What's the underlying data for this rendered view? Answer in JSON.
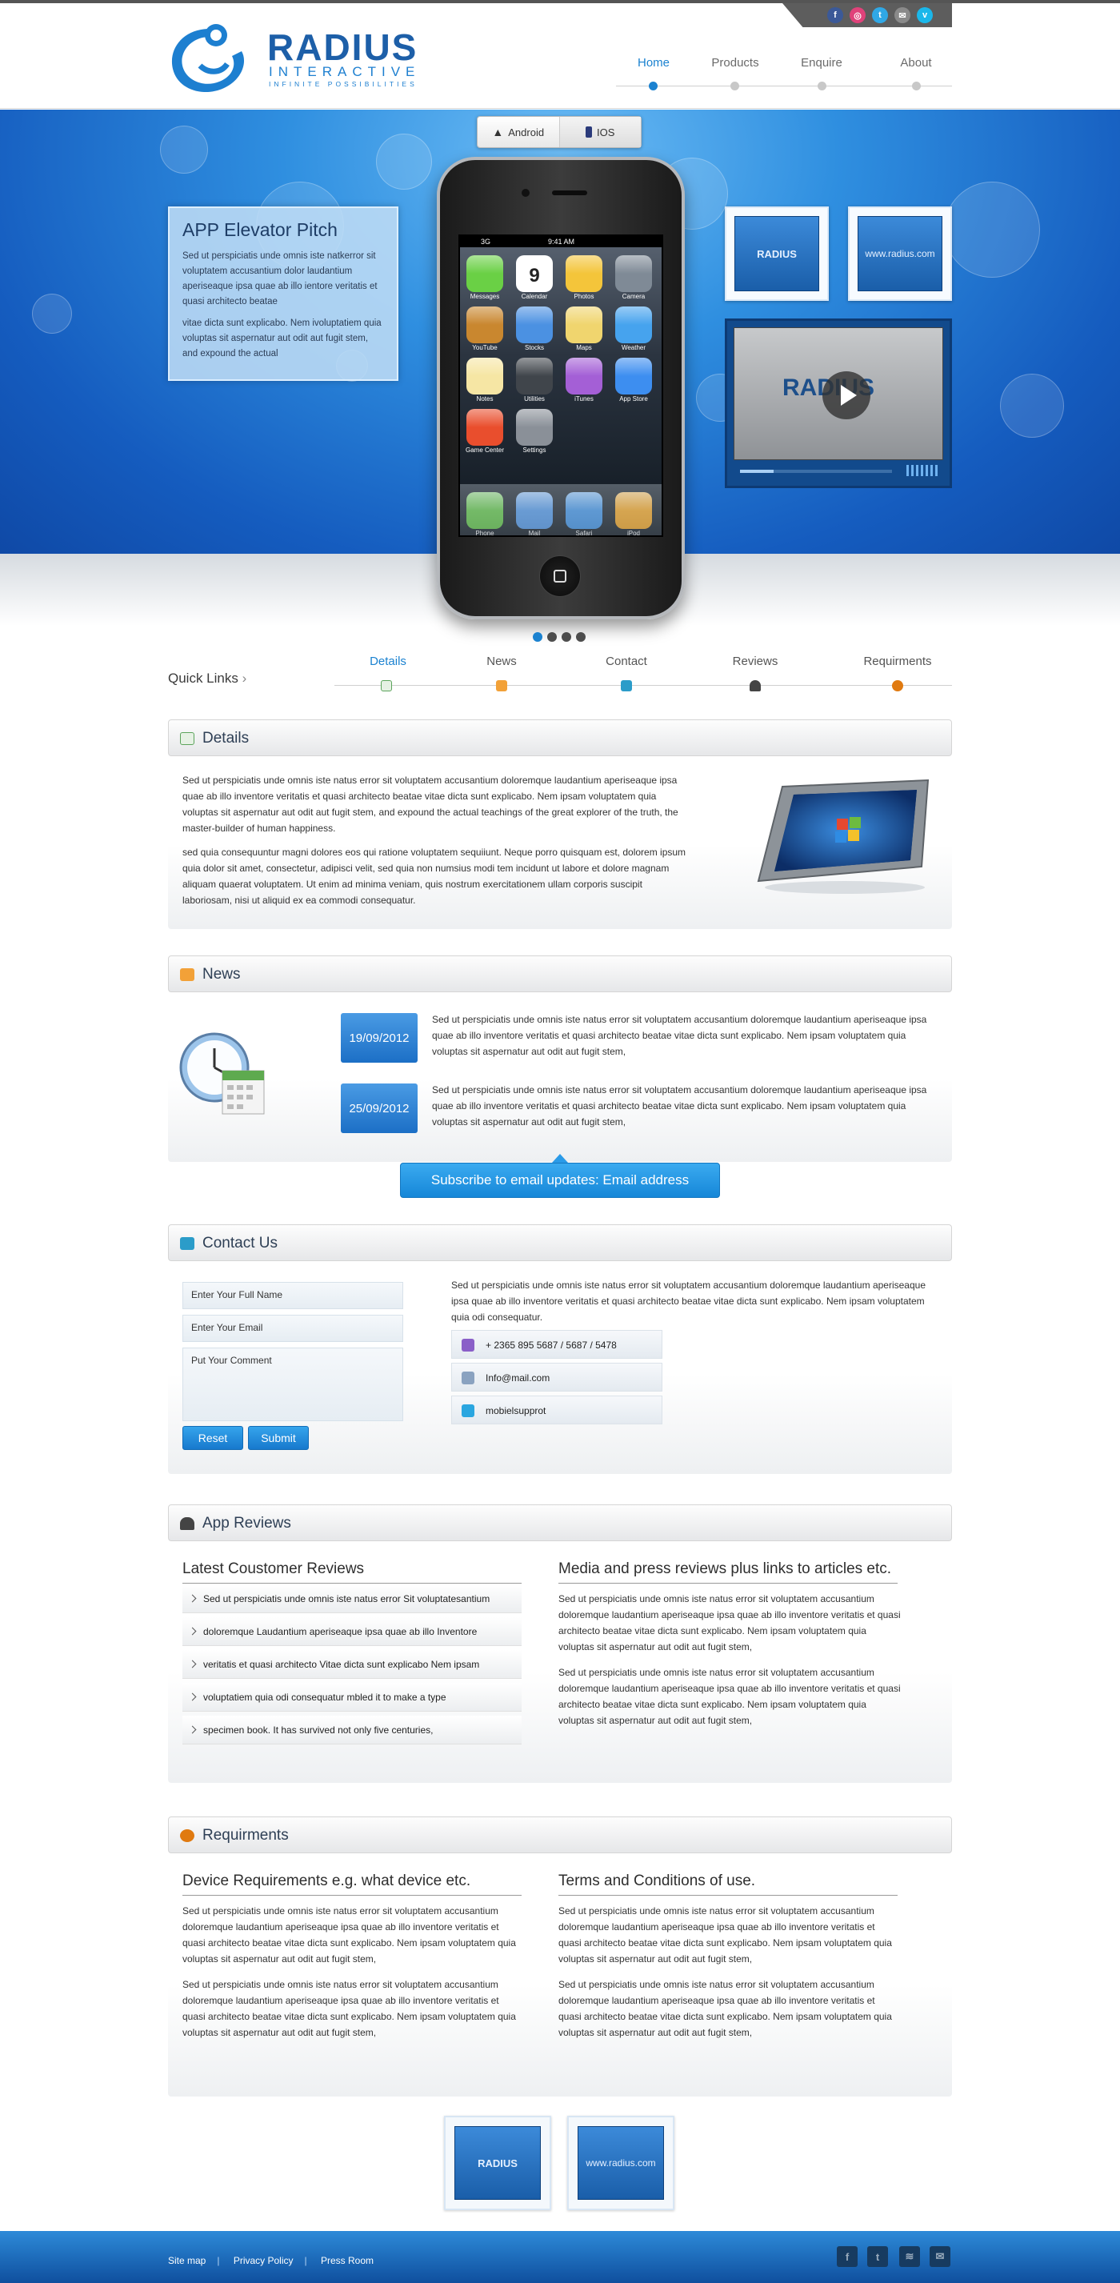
{
  "brand": {
    "name": "RADIUS",
    "sub": "INTERACTIVE",
    "tagline": "INFINITE POSSIBILITIES"
  },
  "social": [
    "f",
    "◎",
    "t",
    "✉",
    "v"
  ],
  "nav": [
    {
      "label": "Home"
    },
    {
      "label": "Products"
    },
    {
      "label": "Enquire"
    },
    {
      "label": "About"
    }
  ],
  "hero": {
    "pitch_title": "APP Elevator Pitch",
    "pitch_p1": "Sed ut perspiciatis unde omnis iste natkerror sit voluptatem accusantium dolor laudantium aperiseaque ipsa quae ab illo ientore veritatis et quasi architecto beatae",
    "pitch_p2": "vitae dicta sunt explicabo. Nem ivoluptatiem quia voluptas sit aspernatur aut odit aut fugit stem, and expound the actual",
    "platform_android": "Android",
    "platform_ios": "IOS",
    "status_carrier": "3G",
    "status_time": "9:41 AM",
    "thumb1": "RADIUS",
    "thumb2": "www.radius.com",
    "video_logo": "RADIUS"
  },
  "apps": [
    {
      "label": "Messages",
      "color": "#6ad045"
    },
    {
      "label": "Calendar",
      "color": "#ffffff"
    },
    {
      "label": "Photos",
      "color": "#f4c53a"
    },
    {
      "label": "Camera",
      "color": "#7f8a96"
    },
    {
      "label": "YouTube",
      "color": "#c9872f"
    },
    {
      "label": "Stocks",
      "color": "#4b91e2"
    },
    {
      "label": "Maps",
      "color": "#f0d56e"
    },
    {
      "label": "Weather",
      "color": "#46a3ee"
    },
    {
      "label": "Notes",
      "color": "#f6e6a4"
    },
    {
      "label": "Utilities",
      "color": "#40454b"
    },
    {
      "label": "iTunes",
      "color": "#a45fd6"
    },
    {
      "label": "App Store",
      "color": "#3d8ef0"
    },
    {
      "label": "Game Center",
      "color": "#e94e2d"
    },
    {
      "label": "Settings",
      "color": "#8a9098"
    },
    {
      "label": "Phone",
      "color": "#5cc23e"
    },
    {
      "label": "Mail",
      "color": "#4c93e4"
    },
    {
      "label": "Safari",
      "color": "#3b8fe3"
    },
    {
      "label": "iPod",
      "color": "#f2a21b"
    }
  ],
  "calendar_day": "9",
  "quick": {
    "label": "Quick Links",
    "items": [
      "Details",
      "News",
      "Contact",
      "Reviews",
      "Requirments"
    ]
  },
  "details": {
    "title": "Details",
    "p1": "Sed ut perspiciatis unde omnis iste natus error sit voluptatem accusantium doloremque laudantium aperiseaque ipsa quae ab illo inventore veritatis et quasi architecto beatae vitae dicta sunt explicabo. Nem ipsam voluptatem quia voluptas sit aspernatur aut odit aut fugit stem, and expound the actual teachings of the great explorer of the truth, the master-builder of human happiness.",
    "p2": "sed quia consequuntur magni dolores eos qui ratione voluptatem sequiiunt. Neque porro quisquam est, dolorem ipsum quia dolor sit amet, consectetur, adipisci velit, sed quia non numsius modi tem incidunt ut labore et dolore magnam aliquam quaerat voluptatem. Ut enim ad minima veniam, quis nostrum exercitationem ullam corporis suscipit laboriosam, nisi ut aliquid ex ea commodi consequatur."
  },
  "news": {
    "title": "News",
    "items": [
      {
        "date": "19/09/2012",
        "text": "Sed ut perspiciatis unde omnis iste natus error sit voluptatem accusantium doloremque laudantium aperiseaque ipsa quae ab illo inventore veritatis et quasi architecto beatae vitae dicta sunt explicabo. Nem ipsam voluptatem quia voluptas sit aspernatur aut odit aut fugit stem,"
      },
      {
        "date": "25/09/2012",
        "text": "Sed ut perspiciatis unde omnis iste natus error sit voluptatem accusantium doloremque laudantium aperiseaque ipsa quae ab illo inventore veritatis et quasi architecto beatae vitae dicta sunt explicabo. Nem ipsam voluptatem quia voluptas sit aspernatur aut odit aut fugit stem,"
      }
    ],
    "subscribe": "Subscribe to email updates: Email address"
  },
  "contact": {
    "title": "Contact Us",
    "name_placeholder": "Enter Your Full Name",
    "email_placeholder": "Enter Your Email",
    "comment_placeholder": "Put Your Comment",
    "reset": "Reset",
    "submit": "Submit",
    "text": "Sed ut perspiciatis unde omnis iste natus error sit voluptatem accusantium doloremque laudantium aperiseaque ipsa quae ab illo inventore veritatis et quasi architecto beatae vitae dicta sunt explicabo. Nem ipsam voluptatem quia odi consequatur.",
    "phone": "+ 2365 895 5687 / 5687 / 5478",
    "email": "Info@mail.com",
    "skype": "mobielsupprot"
  },
  "reviews": {
    "title": "App Reviews",
    "left_title": "Latest Coustomer Reviews",
    "items": [
      "Sed ut perspiciatis unde omnis iste natus error Sit voluptatesantium",
      "doloremque Laudantium aperiseaque ipsa quae ab illo Inventore",
      "veritatis et quasi architecto Vitae dicta sunt explicabo Nem ipsam",
      "voluptatiem quia odi consequatur mbled it to make a type",
      "specimen book. It has survived not only five centuries,"
    ],
    "right_title": "Media and press reviews plus links to articles etc.",
    "right_p1": "Sed ut perspiciatis unde omnis iste natus error sit voluptatem accusantium doloremque laudantium aperiseaque ipsa quae ab illo inventore veritatis et quasi architecto beatae vitae dicta sunt explicabo. Nem ipsam voluptatem quia voluptas sit aspernatur aut odit aut fugit stem,",
    "right_p2": "Sed ut perspiciatis unde omnis iste natus error sit voluptatem accusantium doloremque laudantium aperiseaque ipsa quae ab illo inventore veritatis et quasi architecto beatae vitae dicta sunt explicabo. Nem ipsam voluptatem quia voluptas sit aspernatur aut odit aut fugit stem,"
  },
  "requirements": {
    "title": "Requirments",
    "left_title": "Device Requirements e.g. what device etc.",
    "right_title": "Terms and Conditions of use.",
    "p": "Sed ut perspiciatis unde omnis iste natus error sit voluptatem accusantium doloremque laudantium aperiseaque ipsa quae ab illo inventore veritatis et quasi architecto beatae vitae dicta sunt explicabo. Nem ipsam voluptatem quia voluptas sit aspernatur aut odit aut fugit stem,"
  },
  "footer": {
    "thumb1": "RADIUS",
    "thumb2": "www.radius.com",
    "links": [
      "Site map",
      "Privacy Policy",
      "Press Room"
    ],
    "sep": "|"
  },
  "colors": {
    "accent": "#1b82d0",
    "hero": "#155cbf",
    "footer": "#0f4f9e"
  }
}
